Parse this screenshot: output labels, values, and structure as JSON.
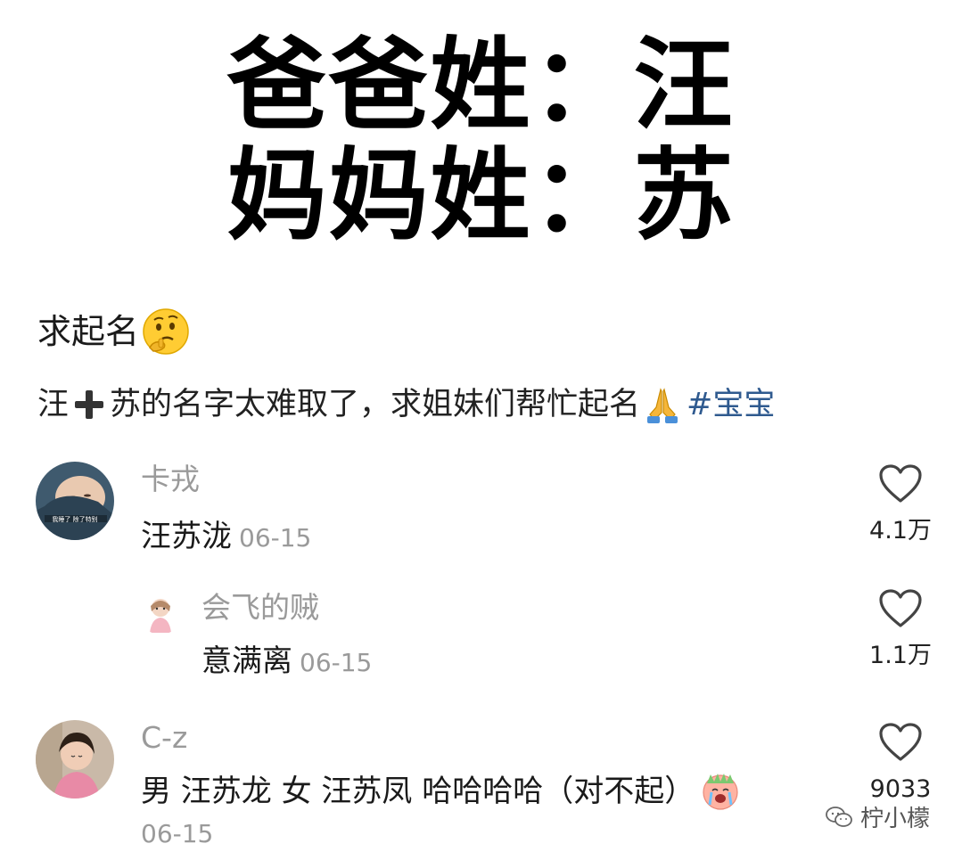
{
  "headline": {
    "line1": "爸爸姓：汪",
    "line2": "妈妈姓：苏"
  },
  "post": {
    "title": "求起名",
    "title_emoji": "thinking-face-icon",
    "body_part1": "汪",
    "body_plus_icon": "heavy-plus-icon",
    "body_part2": "苏的名字太难取了，求姐妹们帮忙起名",
    "body_pray_icon": "folded-hands-icon",
    "hashtag": "#宝宝"
  },
  "comments": [
    {
      "user": "卡戎",
      "text": "汪苏泷",
      "date": "06-15",
      "likes": "4.1万",
      "avatar_caption": "我睡了 除了特别"
    },
    {
      "user": "会飞的贼",
      "text": "意满离",
      "date": "06-15",
      "likes": "1.1万"
    },
    {
      "user": "C-z",
      "text": "男 汪苏龙 女 汪苏凤 哈哈哈哈（对不起）",
      "text_emoji": "crying-face-icon",
      "date": "06-15",
      "likes": "9033"
    }
  ],
  "watermark": {
    "icon": "wechat-icon",
    "label": "柠小檬"
  },
  "colors": {
    "hashtag": "#2f5a8f",
    "muted": "#9a9a9a",
    "text": "#1a1a1a"
  }
}
